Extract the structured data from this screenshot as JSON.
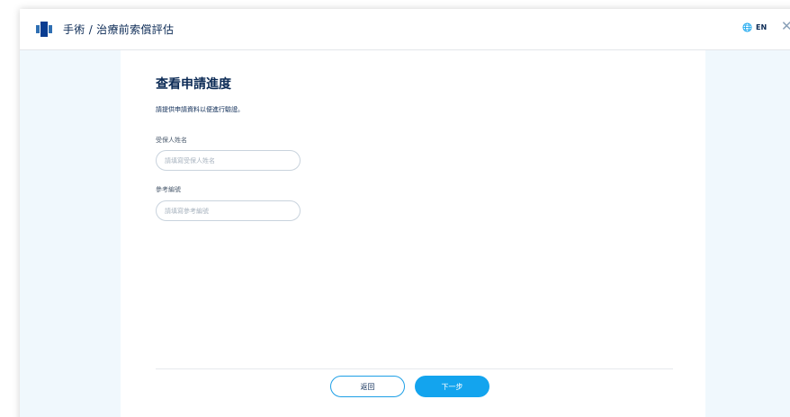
{
  "header": {
    "title": "手術 / 治療前索償評估",
    "lang_label": "EN",
    "logo_icon": "hospital-logo-icon",
    "globe_icon": "globe-icon",
    "close_icon": "close-icon"
  },
  "form": {
    "title": "查看申請進度",
    "instruction": "請提供申請資料以便進行驗證。",
    "fields": [
      {
        "label": "受保人姓名",
        "placeholder": "請填寫受保人姓名",
        "value": ""
      },
      {
        "label": "參考編號",
        "placeholder": "請填寫參考編號",
        "value": ""
      }
    ]
  },
  "actions": {
    "back_label": "返回",
    "next_label": "下一步"
  },
  "colors": {
    "primary": "#13a4ee",
    "text_dark": "#0b2a55",
    "side_bg": "#f0f8fd"
  }
}
